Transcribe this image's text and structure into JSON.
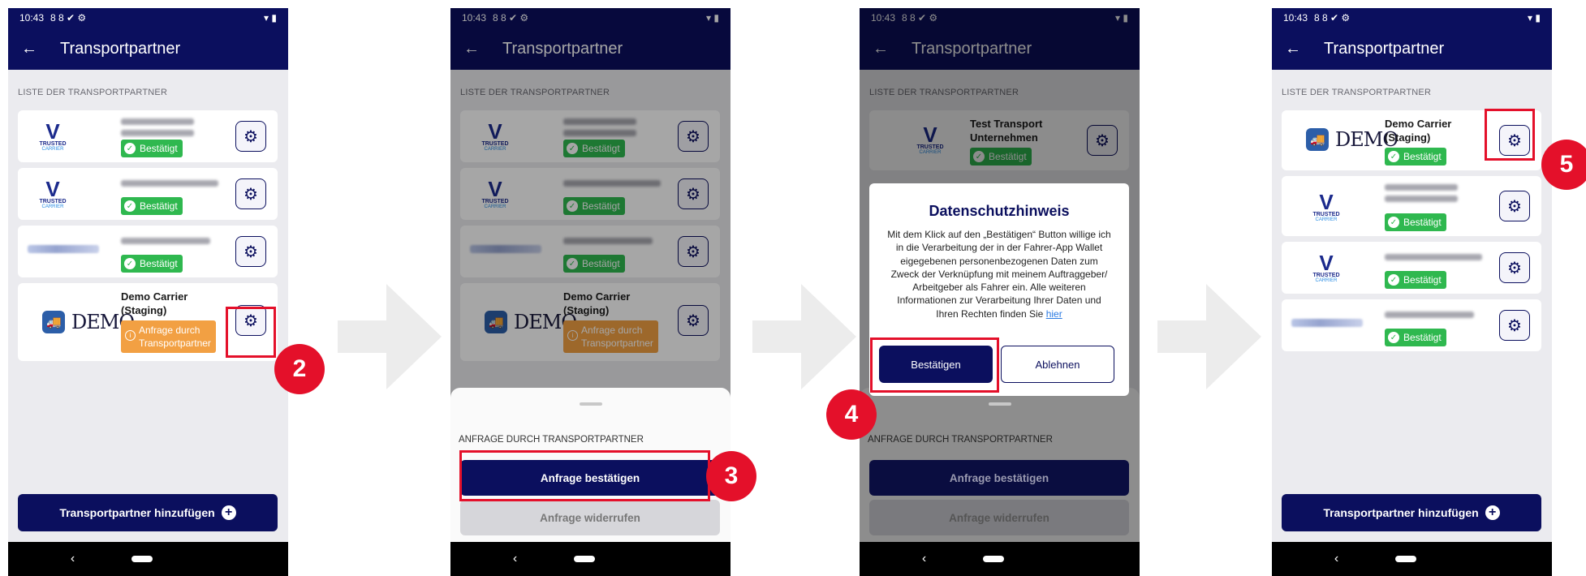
{
  "status": {
    "time": "10:43",
    "icons": "8 8 ✔ ⚙",
    "right": "▾ ▮"
  },
  "appbar": {
    "title": "Transportpartner",
    "back": "←"
  },
  "list_header": "LISTE DER TRANSPORTPARTNER",
  "trusted_logo": {
    "text": "TRUSTED",
    "sub": "CARRIER"
  },
  "demo": {
    "name": "Demo Carrier\n(Staging)",
    "logo": "DEMO"
  },
  "badges": {
    "confirmed": "Bestätigt",
    "request": "Anfrage durch\nTransportpartner"
  },
  "test_company": "Test Transport\nUnternehmen",
  "add_button": "Transportpartner hinzufügen",
  "sheet": {
    "title": "ANFRAGE DURCH TRANSPORTPARTNER",
    "confirm": "Anfrage bestätigen",
    "revoke": "Anfrage widerrufen"
  },
  "dialog": {
    "title": "Datenschutzhinweis",
    "body": "Mit dem Klick auf den „Bestätigen“ Button willige ich in die Verarbeitung der in der Fahrer-App Wallet eigegebenen personenbezogenen Daten zum Zweck der Verknüpfung mit meinem Auftraggeber/ Arbeitgeber als Fahrer ein. Alle weiteren Informationen zur Verarbeitung Ihrer Daten und Ihren Rechten finden Sie",
    "link": "hier",
    "confirm": "Bestätigen",
    "decline": "Ablehnen"
  },
  "steps": {
    "s2": "2",
    "s3": "3",
    "s4": "4",
    "s5": "5"
  },
  "colors": {
    "primary": "#0b0f5e",
    "success": "#2fb84f",
    "pending": "#f2a043",
    "highlight": "#e4102a"
  }
}
